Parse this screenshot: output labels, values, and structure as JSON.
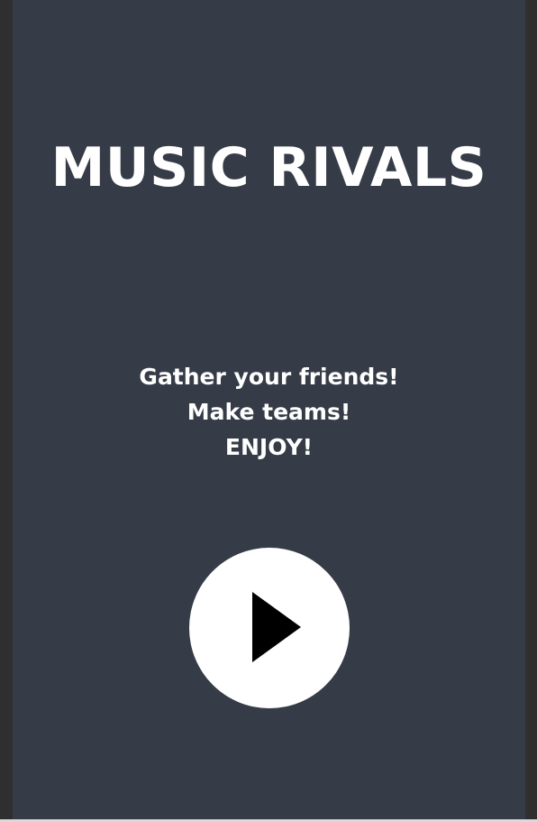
{
  "app": {
    "title": "MUSIC RIVALS"
  },
  "tagline": {
    "lines": [
      "Gather your friends!",
      "Make teams!",
      "ENJOY!"
    ]
  },
  "play_button": {
    "icon": "play-icon"
  },
  "colors": {
    "background": "#363c47",
    "text": "#ffffff",
    "button_bg": "#ffffff",
    "icon": "#000000"
  }
}
